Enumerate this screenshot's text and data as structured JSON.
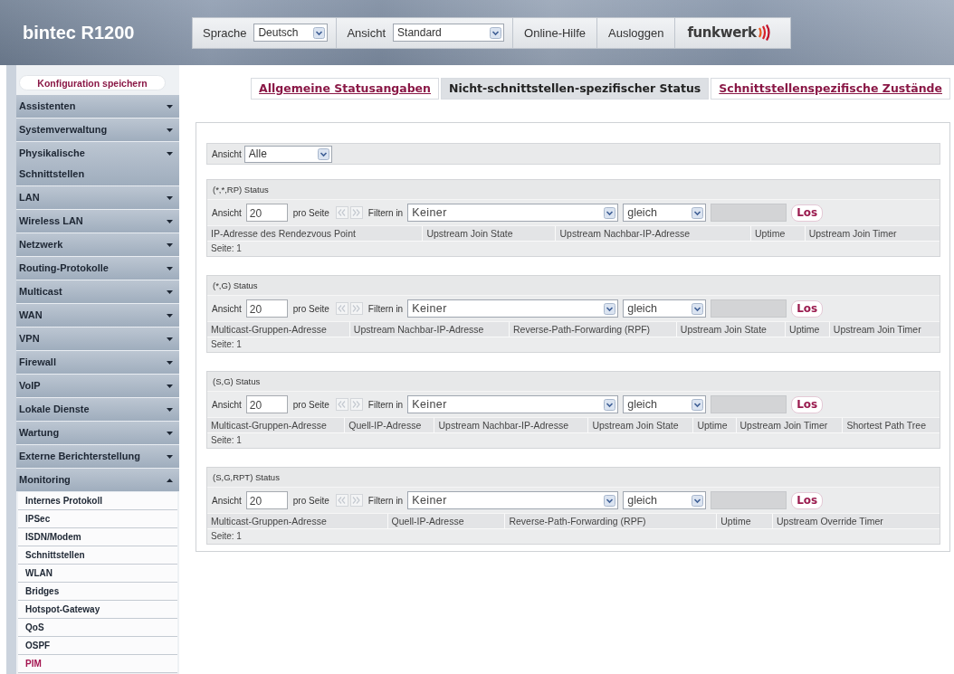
{
  "header": {
    "title": "bintec R1200",
    "toolbar": [
      {
        "kind": "select",
        "label": "Sprache",
        "value": "Deutsch"
      },
      {
        "kind": "select",
        "label": "Ansicht",
        "value": "Standard"
      },
      {
        "kind": "button",
        "label": "Online-Hilfe"
      },
      {
        "kind": "button",
        "label": "Ausloggen"
      }
    ],
    "logo": "funkwerk"
  },
  "sidebar": {
    "save_button": "Konfiguration speichern",
    "items": [
      {
        "label": "Assistenten",
        "expanded": false
      },
      {
        "label": "Systemverwaltung",
        "expanded": false
      },
      {
        "label": "Physikalische Schnittstellen",
        "expanded": false
      },
      {
        "label": "LAN",
        "expanded": false
      },
      {
        "label": "Wireless LAN",
        "expanded": false
      },
      {
        "label": "Netzwerk",
        "expanded": false
      },
      {
        "label": "Routing-Protokolle",
        "expanded": false
      },
      {
        "label": "Multicast",
        "expanded": false
      },
      {
        "label": "WAN",
        "expanded": false
      },
      {
        "label": "VPN",
        "expanded": false
      },
      {
        "label": "Firewall",
        "expanded": false
      },
      {
        "label": "VoIP",
        "expanded": false
      },
      {
        "label": "Lokale Dienste",
        "expanded": false
      },
      {
        "label": "Wartung",
        "expanded": false
      },
      {
        "label": "Externe Berichterstellung",
        "expanded": false
      },
      {
        "label": "Monitoring",
        "expanded": true,
        "children": [
          {
            "label": "Internes Protokoll",
            "selected": false
          },
          {
            "label": "IPSec",
            "selected": false
          },
          {
            "label": "ISDN/Modem",
            "selected": false
          },
          {
            "label": "Schnittstellen",
            "selected": false
          },
          {
            "label": "WLAN",
            "selected": false
          },
          {
            "label": "Bridges",
            "selected": false
          },
          {
            "label": "Hotspot-Gateway",
            "selected": false
          },
          {
            "label": "QoS",
            "selected": false
          },
          {
            "label": "OSPF",
            "selected": false
          },
          {
            "label": "PIM",
            "selected": true
          }
        ]
      }
    ]
  },
  "tabs": [
    {
      "label": "Allgemeine Statusangaben",
      "selected": false
    },
    {
      "label": "Nicht-schnittstellen-spezifischer Status",
      "selected": true
    },
    {
      "label": "Schnittstellenspezifische Zustände",
      "selected": false
    }
  ],
  "view_filter": {
    "label": "Ansicht",
    "value": "Alle"
  },
  "sections": [
    {
      "title": "(*,*,RP) Status",
      "view_label": "Ansicht",
      "per_page": "20",
      "per_page_label": "pro Seite",
      "filter_label": "Filtern in",
      "filter_field": "Keiner",
      "filter_operator": "gleich",
      "go_button": "Los",
      "columns": [
        "IP-Adresse des Rendezvous Point",
        "Upstream Join State",
        "Upstream Nachbar-IP-Adresse",
        "Uptime",
        "Upstream Join Timer"
      ],
      "page_info": "Seite: 1"
    },
    {
      "title": "(*,G) Status",
      "view_label": "Ansicht",
      "per_page": "20",
      "per_page_label": "pro Seite",
      "filter_label": "Filtern in",
      "filter_field": "Keiner",
      "filter_operator": "gleich",
      "go_button": "Los",
      "columns": [
        "Multicast-Gruppen-Adresse",
        "Upstream Nachbar-IP-Adresse",
        "Reverse-Path-Forwarding (RPF)",
        "Upstream Join State",
        "Uptime",
        "Upstream Join Timer"
      ],
      "page_info": "Seite: 1"
    },
    {
      "title": "(S,G) Status",
      "view_label": "Ansicht",
      "per_page": "20",
      "per_page_label": "pro Seite",
      "filter_label": "Filtern in",
      "filter_field": "Keiner",
      "filter_operator": "gleich",
      "go_button": "Los",
      "columns": [
        "Multicast-Gruppen-Adresse",
        "Quell-IP-Adresse",
        "Upstream Nachbar-IP-Adresse",
        "Upstream Join State",
        "Uptime",
        "Upstream Join Timer",
        "Shortest Path Tree"
      ],
      "page_info": "Seite: 1"
    },
    {
      "title": "(S,G,RPT) Status",
      "view_label": "Ansicht",
      "per_page": "20",
      "per_page_label": "pro Seite",
      "filter_label": "Filtern in",
      "filter_field": "Keiner",
      "filter_operator": "gleich",
      "go_button": "Los",
      "columns": [
        "Multicast-Gruppen-Adresse",
        "Quell-IP-Adresse",
        "Reverse-Path-Forwarding (RPF)",
        "Uptime",
        "Upstream Override Timer"
      ],
      "page_info": "Seite: 1"
    }
  ]
}
